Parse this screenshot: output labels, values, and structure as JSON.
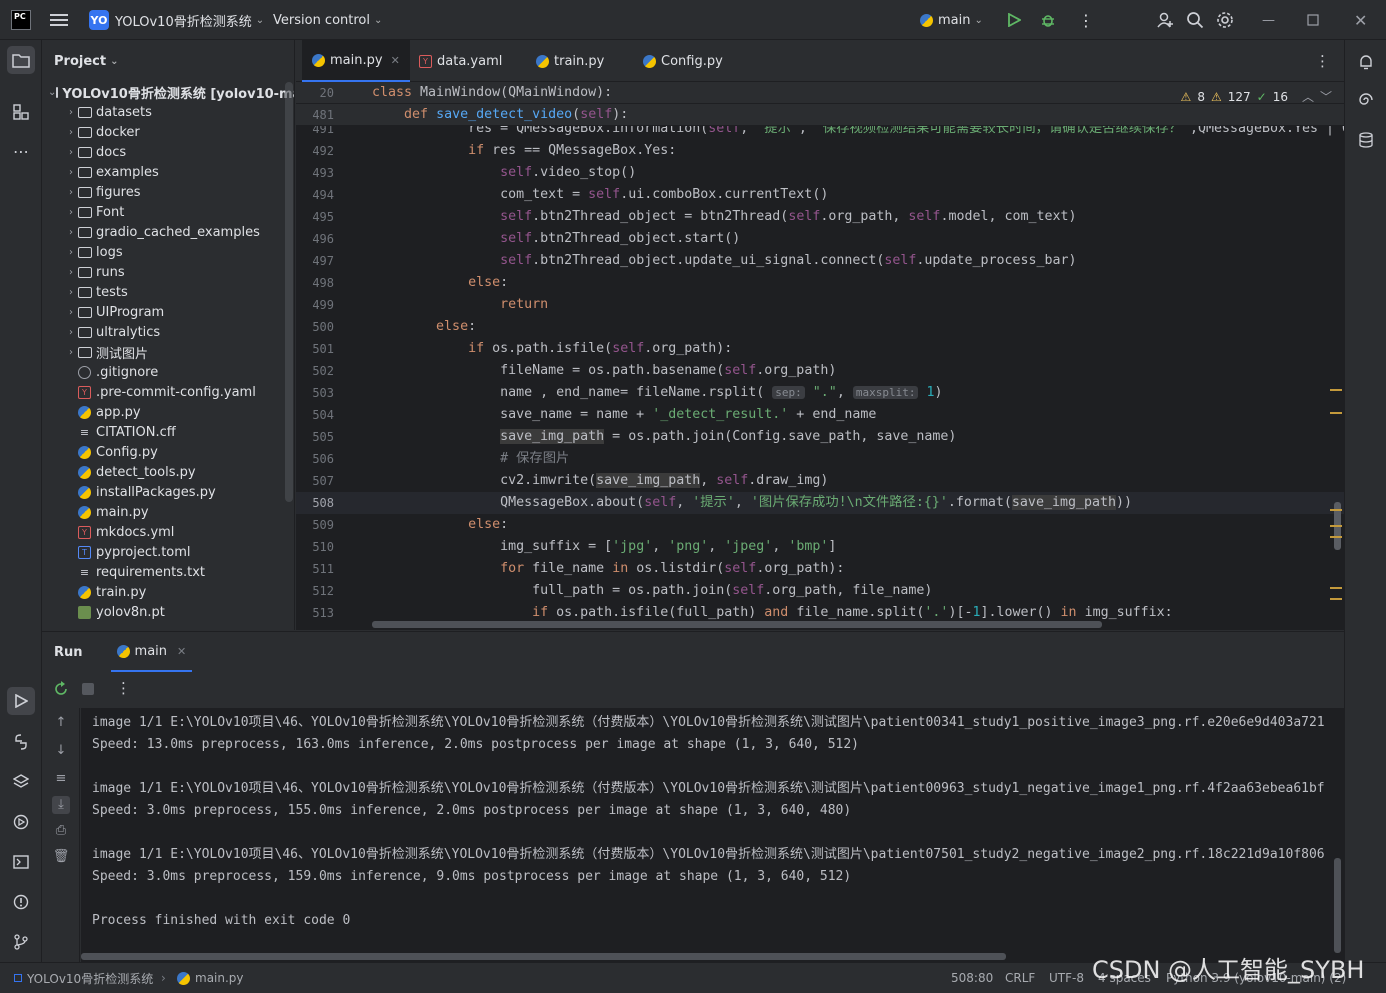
{
  "titlebar": {
    "logo": "PC",
    "menu_icon": "hamburger-icon",
    "project_badge": "YO",
    "project_name": "YOLOv10骨折检测系统",
    "vcs": "Version control",
    "run_config": "main"
  },
  "project_panel": {
    "title": "Project",
    "root": "YOLOv10骨折检测系统 [yolov10-main]",
    "folders": [
      "datasets",
      "docker",
      "docs",
      "examples",
      "figures",
      "Font",
      "gradio_cached_examples",
      "logs",
      "runs",
      "tests",
      "UIProgram",
      "ultralytics",
      "测试图片"
    ],
    "files": [
      {
        "name": ".gitignore",
        "type": "git"
      },
      {
        "name": ".pre-commit-config.yaml",
        "type": "yaml"
      },
      {
        "name": "app.py",
        "type": "py"
      },
      {
        "name": "CITATION.cff",
        "type": "txt"
      },
      {
        "name": "Config.py",
        "type": "py"
      },
      {
        "name": "detect_tools.py",
        "type": "py"
      },
      {
        "name": "installPackages.py",
        "type": "py"
      },
      {
        "name": "main.py",
        "type": "py"
      },
      {
        "name": "mkdocs.yml",
        "type": "yaml"
      },
      {
        "name": "pyproject.toml",
        "type": "toml"
      },
      {
        "name": "requirements.txt",
        "type": "txt"
      },
      {
        "name": "train.py",
        "type": "py"
      },
      {
        "name": "yolov8n.pt",
        "type": "pt"
      }
    ]
  },
  "tabs": [
    {
      "label": "main.py",
      "type": "py",
      "active": true
    },
    {
      "label": "data.yaml",
      "type": "yaml",
      "active": false
    },
    {
      "label": "train.py",
      "type": "py",
      "active": false
    },
    {
      "label": "Config.py",
      "type": "py",
      "active": false
    }
  ],
  "inspections": {
    "warnings": "8",
    "weak_warnings": "127",
    "typos": "16"
  },
  "sticky": [
    {
      "ln": "20",
      "html": "<span class=\"kw\">class</span> MainWindow(QMainWindow):"
    },
    {
      "ln": "481",
      "html": "    <span class=\"kw\">def</span> <span class=\"fn\">save_detect_video</span>(<span class=\"self\">self</span>):"
    }
  ],
  "code_lines": [
    {
      "ln": "491",
      "html": "            res = QMessageBox.information(<span class=\"self\">self</span>, <span class=\"str\">'提示'</span>, <span class=\"str\">'保存视频检测结果可能需要较长时间，请确认是否继续保存？'</span>,QMessageBox.Yes | Q"
    },
    {
      "ln": "492",
      "html": "            <span class=\"kw\">if</span> res == QMessageBox.Yes:"
    },
    {
      "ln": "493",
      "html": "                <span class=\"self\">self</span>.video_stop()"
    },
    {
      "ln": "494",
      "html": "                com_text = <span class=\"self\">self</span>.ui.comboBox.currentText()"
    },
    {
      "ln": "495",
      "html": "                <span class=\"self\">self</span>.btn2Thread_object = btn2Thread(<span class=\"self\">self</span>.org_path, <span class=\"self\">self</span>.model, com_text)"
    },
    {
      "ln": "496",
      "html": "                <span class=\"self\">self</span>.btn2Thread_object.start()"
    },
    {
      "ln": "497",
      "html": "                <span class=\"self\">self</span>.btn2Thread_object.update_ui_signal.connect(<span class=\"self\">self</span>.update_process_bar)"
    },
    {
      "ln": "498",
      "html": "            <span class=\"kw\">else</span>:"
    },
    {
      "ln": "499",
      "html": "                <span class=\"kw\">return</span>"
    },
    {
      "ln": "500",
      "html": "        <span class=\"kw\">else</span>:"
    },
    {
      "ln": "501",
      "html": "            <span class=\"kw\">if</span> os.path.isfile(<span class=\"self\">self</span>.org_path):"
    },
    {
      "ln": "502",
      "html": "                fileName = os.path.basename(<span class=\"self\">self</span>.org_path)"
    },
    {
      "ln": "503",
      "html": "                name , end_name= fileName.rsplit( <span class=\"hint\">sep:</span> <span class=\"str\">\".\"</span>, <span class=\"hint\">maxsplit:</span> <span class=\"num\">1</span>)"
    },
    {
      "ln": "504",
      "html": "                save_name = name + <span class=\"str\">'_detect_result.'</span> + end_name"
    },
    {
      "ln": "505",
      "html": "                <span class=\"hl\">save_img_path</span> = os.path.join(Config.save_path, save_name)"
    },
    {
      "ln": "506",
      "html": "                <span class=\"cmt\"># 保存图片</span>"
    },
    {
      "ln": "507",
      "html": "                cv2.imwrite(<span class=\"hl\">save_img_path</span>, <span class=\"self\">self</span>.draw_img)"
    },
    {
      "ln": "508",
      "html": "                QMessageBox.about(<span class=\"self\">self</span>, <span class=\"str\">'提示'</span>, <span class=\"str\">'图片保存成功!\\n文件路径:{}'</span>.format(<span class=\"hl\">save_img_path</span>))"
    },
    {
      "ln": "509",
      "html": "            <span class=\"kw\">else</span>:"
    },
    {
      "ln": "510",
      "html": "                img_suffix = [<span class=\"str\">'jpg'</span>, <span class=\"str\">'png'</span>, <span class=\"str\">'jpeg'</span>, <span class=\"str\">'bmp'</span>]"
    },
    {
      "ln": "511",
      "html": "                <span class=\"kw\">for</span> file_name <span class=\"kw\">in</span> os.listdir(<span class=\"self\">self</span>.org_path):"
    },
    {
      "ln": "512",
      "html": "                    full_path = os.path.join(<span class=\"self\">self</span>.org_path, file_name)"
    },
    {
      "ln": "513",
      "html": "                    <span class=\"kw\">if</span> os.path.isfile(full_path) <span class=\"kw\">and</span> file_name.split(<span class=\"str\">'.'</span>)[-<span class=\"num\">1</span>].lower() <span class=\"kw\">in</span> img_suffix:"
    }
  ],
  "current_line": "508",
  "run": {
    "title": "Run",
    "tab": "main",
    "console": [
      "image 1/1 E:\\YOLOv10项目\\46、YOLOv10骨折检测系统\\YOLOv10骨折检测系统（付费版本）\\YOLOv10骨折检测系统\\测试图片\\patient00341_study1_positive_image3_png.rf.e20e6e9d403a721",
      "Speed: 13.0ms preprocess, 163.0ms inference, 2.0ms postprocess per image at shape (1, 3, 640, 512)",
      "",
      "image 1/1 E:\\YOLOv10项目\\46、YOLOv10骨折检测系统\\YOLOv10骨折检测系统（付费版本）\\YOLOv10骨折检测系统\\测试图片\\patient00963_study1_negative_image1_png.rf.4f2aa63ebea61bf",
      "Speed: 3.0ms preprocess, 155.0ms inference, 2.0ms postprocess per image at shape (1, 3, 640, 480)",
      "",
      "image 1/1 E:\\YOLOv10项目\\46、YOLOv10骨折检测系统\\YOLOv10骨折检测系统（付费版本）\\YOLOv10骨折检测系统\\测试图片\\patient07501_study2_negative_image2_png.rf.18c221d9a10f806",
      "Speed: 3.0ms preprocess, 159.0ms inference, 9.0ms postprocess per image at shape (1, 3, 640, 512)",
      "",
      "Process finished with exit code 0"
    ]
  },
  "statusbar": {
    "breadcrumb_project": "YOLOv10骨折检测系统",
    "breadcrumb_file": "main.py",
    "position": "508:80",
    "line_sep": "CRLF",
    "encoding": "UTF-8",
    "indent": "4 spaces",
    "interpreter": "Python 3.9 (yolov10-main) (2)"
  },
  "watermark": "CSDN @人工智能_SYBH",
  "colors": {
    "accent": "#3574f0",
    "bg": "#2b2d30",
    "editor_bg": "#1e1f22"
  }
}
